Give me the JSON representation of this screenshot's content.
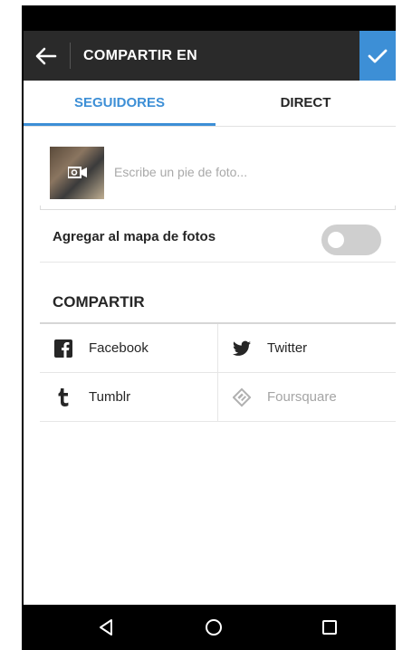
{
  "header": {
    "title": "COMPARTIR EN"
  },
  "tabs": [
    {
      "label": "SEGUIDORES",
      "active": true
    },
    {
      "label": "DIRECT",
      "active": false
    }
  ],
  "caption": {
    "placeholder": "Escribe un pie de foto...",
    "value": ""
  },
  "photo_map": {
    "label": "Agregar al mapa de fotos",
    "enabled": false
  },
  "share": {
    "header": "COMPARTIR",
    "services": [
      {
        "label": "Facebook",
        "icon": "facebook-icon",
        "enabled": true
      },
      {
        "label": "Twitter",
        "icon": "twitter-icon",
        "enabled": true
      },
      {
        "label": "Tumblr",
        "icon": "tumblr-icon",
        "enabled": true
      },
      {
        "label": "Foursquare",
        "icon": "foursquare-icon",
        "enabled": false
      }
    ]
  },
  "colors": {
    "accent": "#3d8fd6",
    "appbar": "#2a2a2a",
    "toggle_off": "#cfcfcf"
  }
}
